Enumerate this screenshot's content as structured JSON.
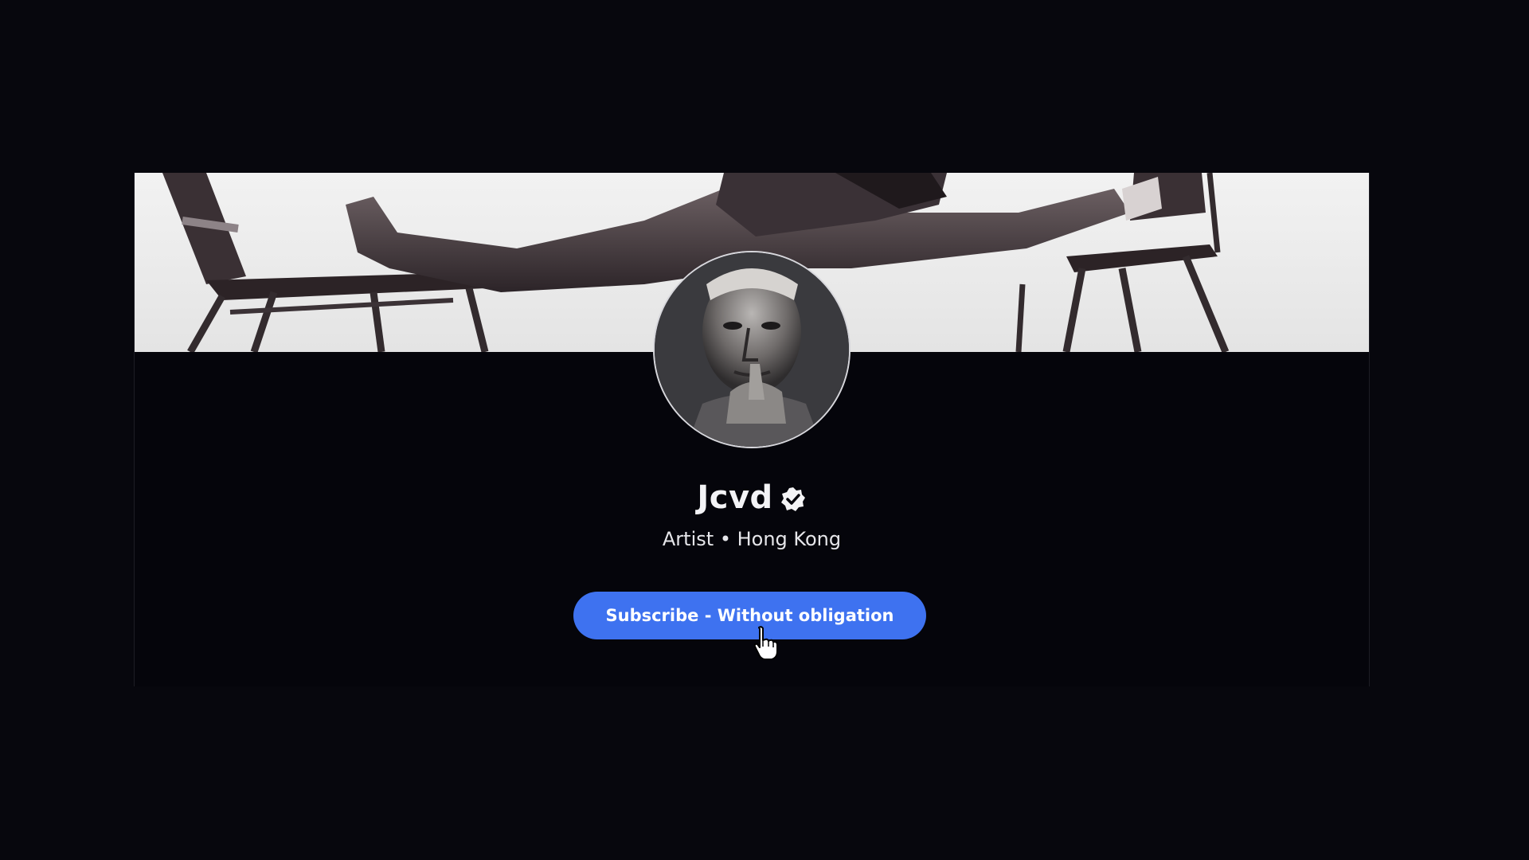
{
  "profile": {
    "name": "Jcvd",
    "category": "Artist",
    "separator": "•",
    "location": "Hong Kong",
    "verified_icon": "verified-badge-icon",
    "verified": true
  },
  "actions": {
    "subscribe_label": "Subscribe - Without obligation"
  },
  "colors": {
    "page_background": "#07070d",
    "card_background": "#05050b",
    "button": "#3e72f0",
    "text_primary": "#f3f3f6"
  },
  "icons": {
    "cursor": "hand-pointer-cursor-icon"
  }
}
